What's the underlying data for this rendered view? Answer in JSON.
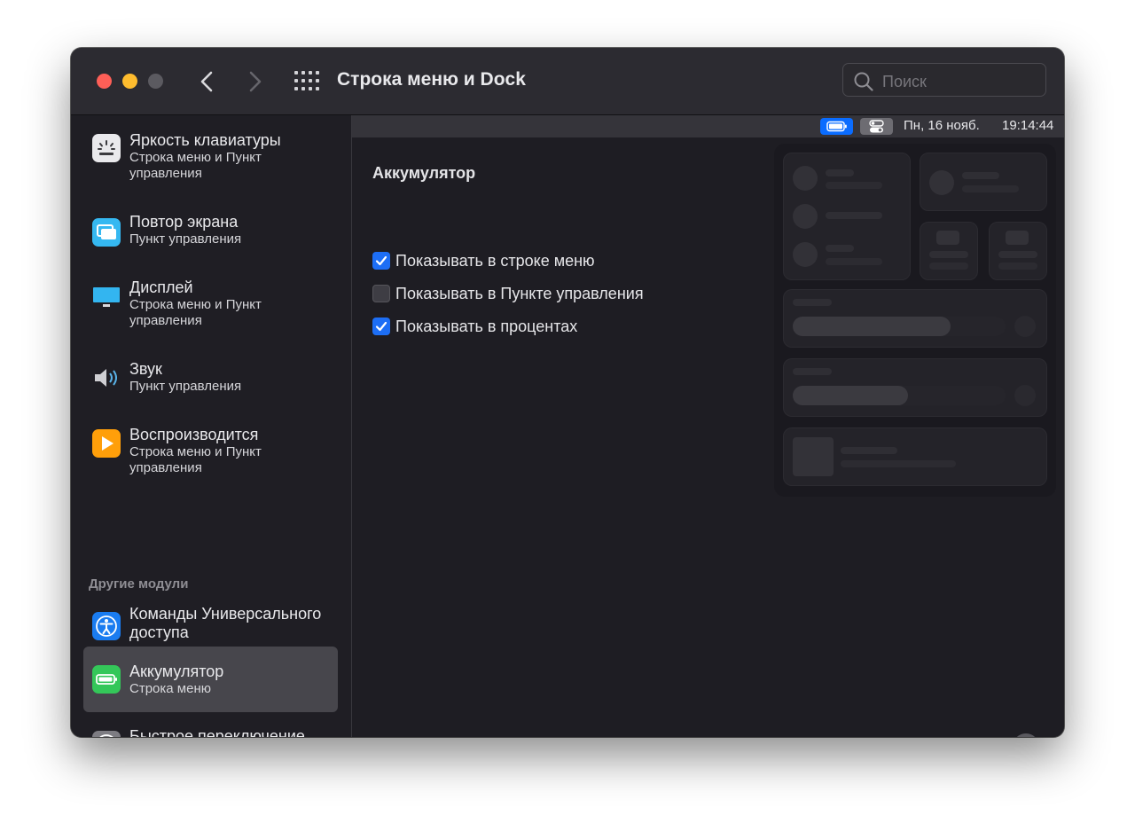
{
  "window": {
    "title": "Строка меню и Dock",
    "search_placeholder": "Поиск"
  },
  "sidebar": {
    "items": [
      {
        "title": "Яркость клавиатуры",
        "subtitle": "Строка меню и Пункт управления",
        "icon": "keyboard-brightness-icon"
      },
      {
        "title": "Повтор экрана",
        "subtitle": "Пункт управления",
        "icon": "screen-mirroring-icon"
      },
      {
        "title": "Дисплей",
        "subtitle": "Строка меню и Пункт управления",
        "icon": "display-icon"
      },
      {
        "title": "Звук",
        "subtitle": "Пункт управления",
        "icon": "speaker-icon"
      },
      {
        "title": "Воспроизводится",
        "subtitle": "Строка меню и Пункт управления",
        "icon": "now-playing-icon"
      }
    ],
    "section_header": "Другие модули",
    "other_items": [
      {
        "title": "Команды Универсального доступа",
        "subtitle": "",
        "icon": "accessibility-icon"
      },
      {
        "title": "Аккумулятор",
        "subtitle": "Строка меню",
        "icon": "battery-icon",
        "selected": true
      },
      {
        "title": "Быстрое переключение пользователей",
        "subtitle": "",
        "icon": "user-switch-icon"
      }
    ]
  },
  "menubar_preview": {
    "date": "Пн, 16 нояб.",
    "time": "19:14:44",
    "icons": [
      "battery-icon",
      "control-center-icon"
    ]
  },
  "content": {
    "section_title": "Аккумулятор",
    "options": [
      {
        "label": "Показывать в строке меню",
        "checked": true
      },
      {
        "label": "Показывать в Пункте управления",
        "checked": false
      },
      {
        "label": "Показывать в процентах",
        "checked": true
      }
    ],
    "help": "?"
  },
  "colors": {
    "accent": "#1d6ef5",
    "close": "#fe5f57",
    "minimize": "#febc2e",
    "battery_icon": "#34c759",
    "now_playing_icon": "#ff9f0a"
  }
}
